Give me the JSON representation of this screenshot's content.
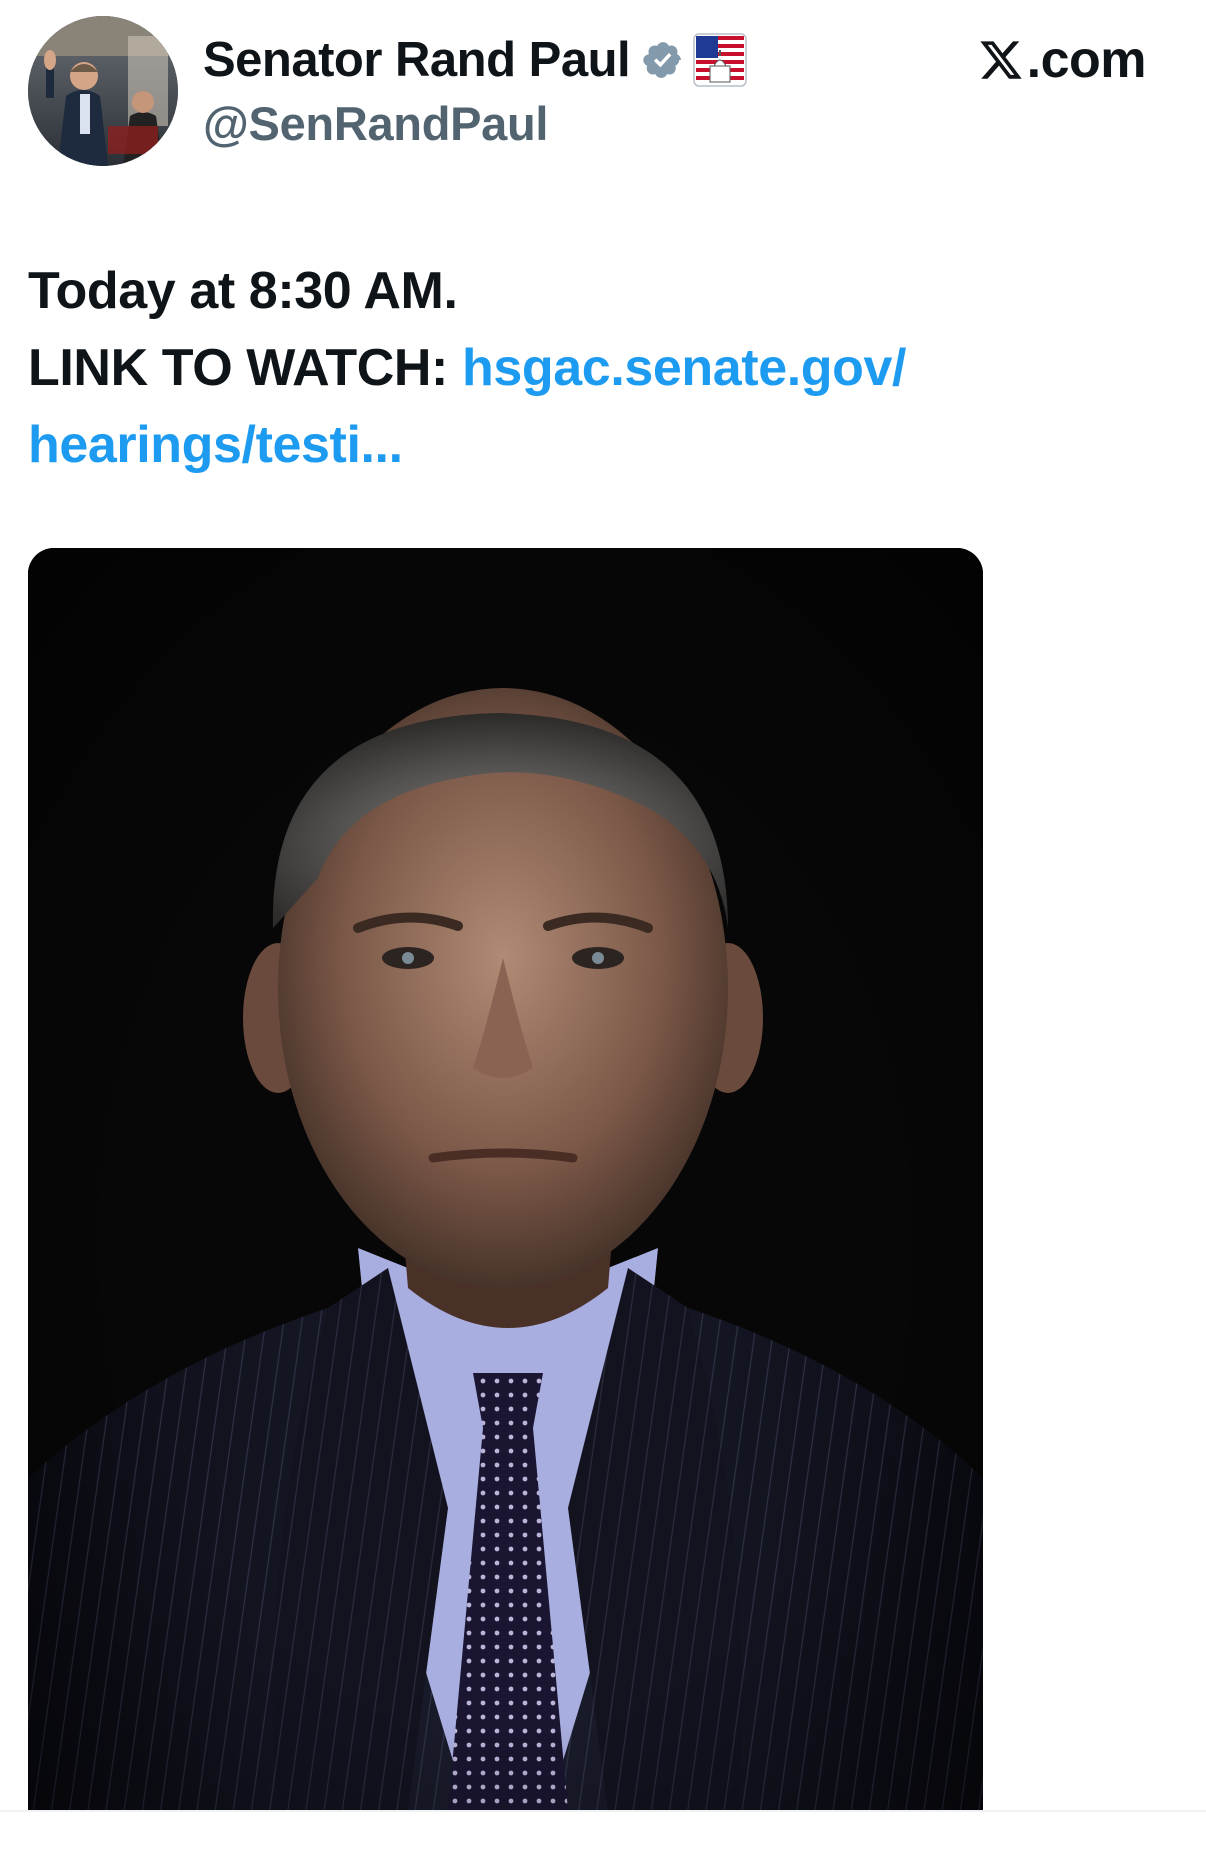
{
  "author": {
    "display_name": "Senator Rand Paul",
    "handle": "@SenRandPaul",
    "verified_icon": "verified-badge-icon",
    "affiliate_badge_icon": "us-capitol-flag-icon",
    "avatar_desc_icon": "profile-avatar"
  },
  "source": {
    "site_label": ".com",
    "logo_icon": "x-logo-icon"
  },
  "tweet": {
    "line1": "Today at 8:30 AM.",
    "line2_prefix": "LINK TO WATCH: ",
    "link_part1": "hsgac.senate.gov/",
    "link_part2": "hearings/testi..."
  },
  "media": {
    "icon": "portrait-photo"
  },
  "colors": {
    "link": "#1d9bf0",
    "handle": "#536471",
    "text": "#0f1419",
    "verified": "#829aab"
  }
}
